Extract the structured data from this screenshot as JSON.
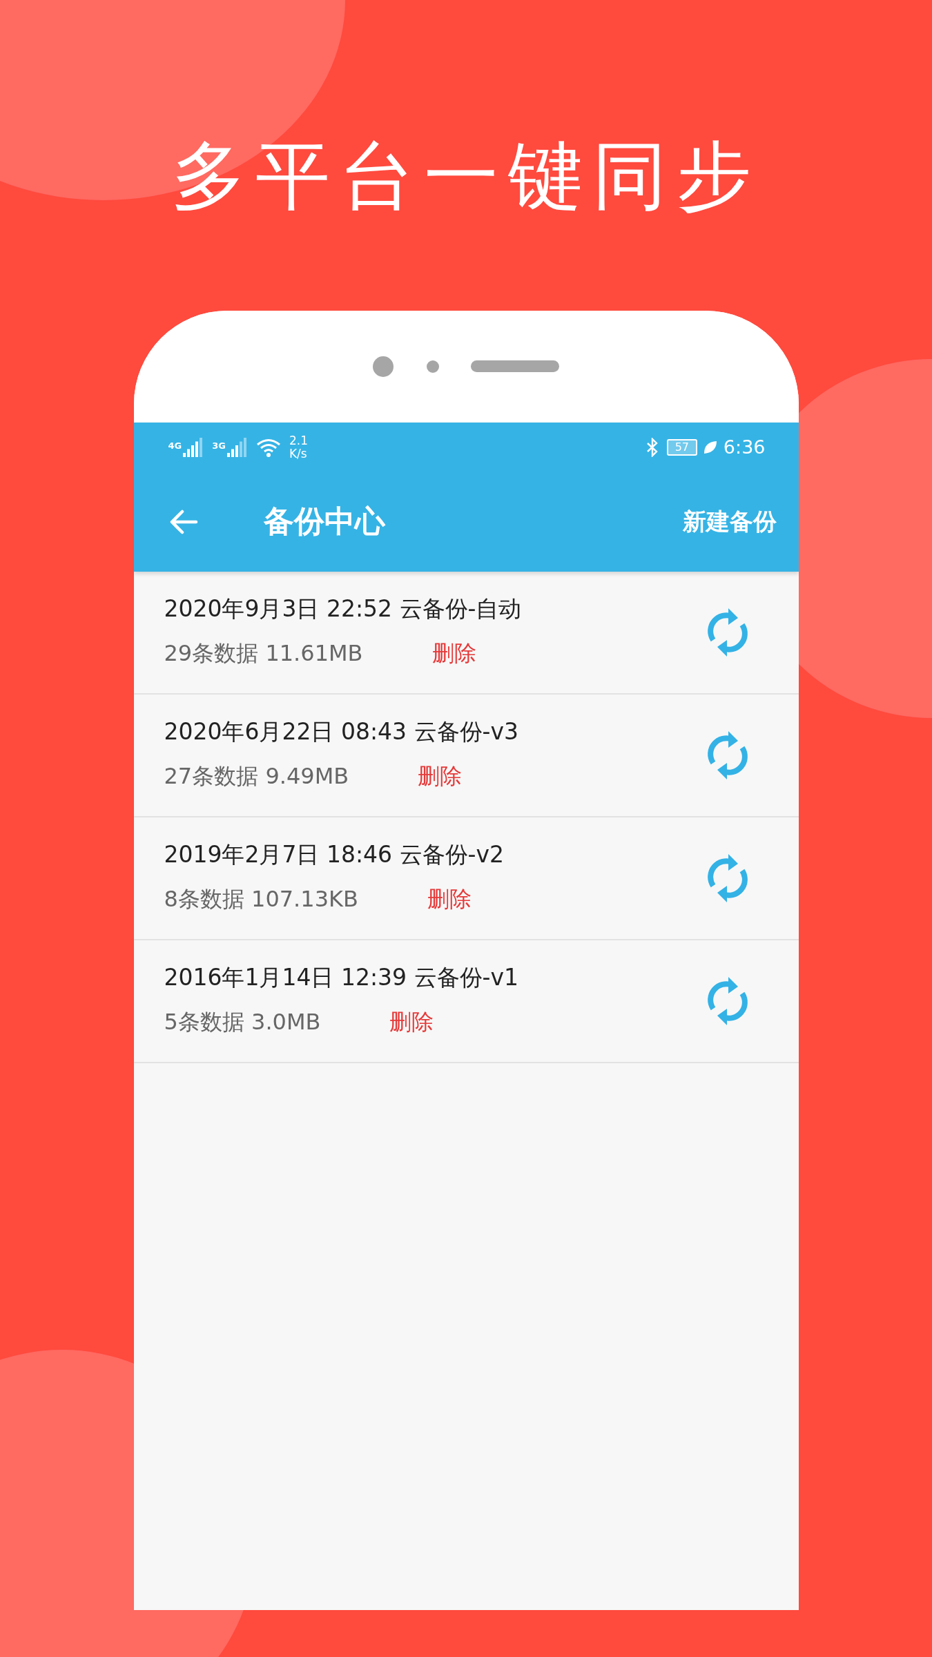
{
  "headline": "多平台一键同步",
  "status_bar": {
    "network_types": [
      "4G",
      "3G"
    ],
    "speed_value": "2.1",
    "speed_unit": "K/s",
    "battery": "57",
    "time": "6:36"
  },
  "app_bar": {
    "title": "备份中心",
    "action": "新建备份"
  },
  "backups": [
    {
      "title": "2020年9月3日 22:52 云备份-自动",
      "info": "29条数据 11.61MB",
      "delete": "删除"
    },
    {
      "title": "2020年6月22日 08:43 云备份-v3",
      "info": "27条数据 9.49MB",
      "delete": "删除"
    },
    {
      "title": "2019年2月7日 18:46 云备份-v2",
      "info": "8条数据 107.13KB",
      "delete": "删除"
    },
    {
      "title": "2016年1月14日 12:39 云备份-v1",
      "info": "5条数据 3.0MB",
      "delete": "删除"
    }
  ]
}
